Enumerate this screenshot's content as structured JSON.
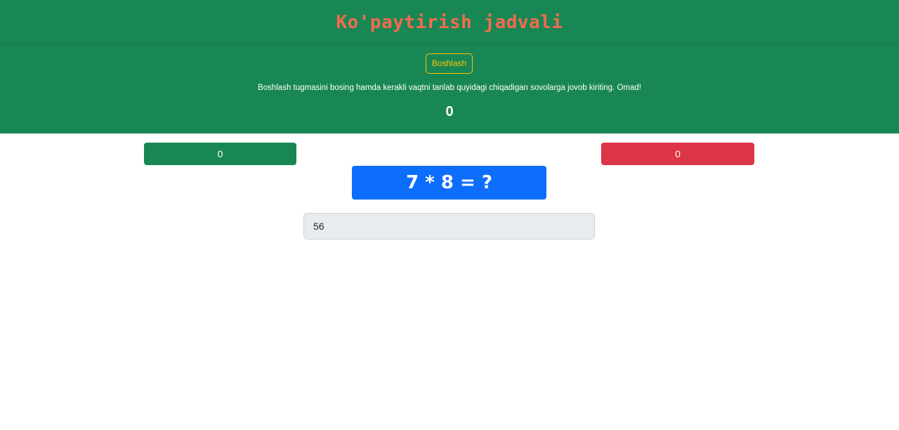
{
  "header": {
    "title": "Ko'paytirish jadvali"
  },
  "controls": {
    "start_label": "Boshlash",
    "instructions": "Boshlash tugmasini bosing hamda kerakli vaqtni tanlab quyidagi chiqadigan sovolarga jovob kiriting. Omad!",
    "timer": "0"
  },
  "scores": {
    "correct": "0",
    "wrong": "0"
  },
  "question": {
    "text": "7 * 8 = ?"
  },
  "answer": {
    "value": "56"
  },
  "colors": {
    "primary_green": "#198754",
    "title_color": "#f26b4f",
    "warning_yellow": "#ffc107",
    "danger_red": "#dc3545",
    "primary_blue": "#0d6efd"
  }
}
